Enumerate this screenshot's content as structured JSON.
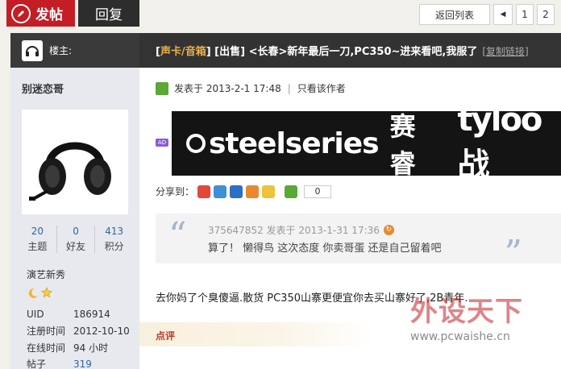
{
  "toolbar": {
    "post_label": "发帖",
    "reply_label": "回复"
  },
  "pager": {
    "back_label": "返回列表",
    "prev_label": "◀",
    "pages": [
      "1",
      "2"
    ]
  },
  "thread": {
    "author_label": "楼主:",
    "category": "声卡/音箱",
    "title": "[出售] <长春>新年最后一刀,PC350~进来看吧,我服了",
    "copy_link": "[复制链接]"
  },
  "profile": {
    "username": "别迷恋哥",
    "stats": [
      {
        "num": "20",
        "label": "主题"
      },
      {
        "num": "0",
        "label": "好友"
      },
      {
        "num": "413",
        "label": "积分"
      }
    ],
    "rank": "演艺新秀",
    "info": [
      {
        "key": "UID",
        "value": "186914"
      },
      {
        "key": "注册时间",
        "value": "2012-10-10"
      },
      {
        "key": "在线时间",
        "value": "94 小时"
      },
      {
        "key": "帖子",
        "value": "319"
      }
    ]
  },
  "post": {
    "posted_prefix": "发表于",
    "posted_time": "2013-2-1 17:48",
    "author_only": "只看该作者",
    "ad_tag": "AD",
    "banner": {
      "brand": "steelseries",
      "cn": "赛睿",
      "partner": "tyloo战"
    },
    "share_label": "分享到：",
    "share_count": "0",
    "quote": {
      "user": "375647852",
      "posted_prefix": "发表于",
      "time": "2013-1-31 17:36",
      "text": "算了！  懒得鸟  这次态度  你卖哥蛋  还是自己留着吧"
    },
    "body": "去你妈了个臭傻逼.散货  PC350山寨更便宜你去买山寨好了,2B青年.",
    "rate_label": "点评"
  },
  "watermark": {
    "title": "外设天下",
    "url": "www.pcwaishe.cn"
  },
  "colors": {
    "accent_red": "#c41d25",
    "header_dark": "#333333",
    "link_blue": "#336699",
    "category_orange": "#e9b04a"
  }
}
